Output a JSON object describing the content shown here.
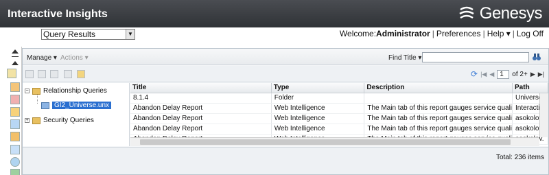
{
  "header": {
    "app_title": "Interactive Insights",
    "logo_text": "Genesys"
  },
  "subheader": {
    "view_select": "Query Results",
    "welcome_prefix": "Welcome:",
    "user": "Administrator",
    "preferences": "Preferences",
    "help": "Help",
    "logoff": "Log Off"
  },
  "toolbar": {
    "manage": "Manage",
    "actions": "Actions",
    "find_title": "Find Title",
    "search_value": ""
  },
  "pager": {
    "current_page": "1",
    "of_pages": "of 2+"
  },
  "tree": {
    "items": [
      {
        "label": "Relationship Queries"
      },
      {
        "label": "GI2_Universe.unx"
      },
      {
        "label": "Security Queries"
      }
    ]
  },
  "grid": {
    "columns": [
      "Title",
      "Type",
      "Description",
      "Path"
    ],
    "rows": [
      [
        "8.1.4",
        "Folder",
        "",
        "Universes"
      ],
      [
        "Abandon Delay Report",
        "Web Intelligence",
        "The Main tab of this report gauges service quali",
        "Interactiv"
      ],
      [
        "Abandon Delay Report",
        "Web Intelligence",
        "The Main tab of this report gauges service quali",
        "asokolov."
      ],
      [
        "Abandon Delay Report",
        "Web Intelligence",
        "The Main tab of this report gauges service quali",
        "asokolov."
      ],
      [
        "Abandon Delay Report",
        "Web Intelligence",
        "The Main tab of this report gauges service quali",
        "asokolov."
      ]
    ]
  },
  "status": {
    "total": "Total: 236 items"
  }
}
